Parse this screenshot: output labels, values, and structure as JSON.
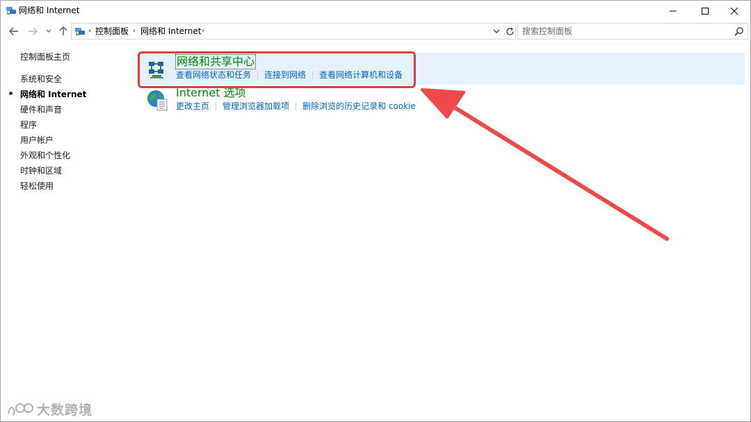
{
  "window": {
    "title": "网络和 Internet"
  },
  "address_bar": {
    "breadcrumbs": [
      "控制面板",
      "网络和 Internet"
    ],
    "search_placeholder": "搜索控制面板"
  },
  "left_nav": {
    "items": [
      {
        "label": "控制面板主页"
      },
      {
        "label": "系统和安全"
      },
      {
        "label": "网络和 Internet",
        "active": true
      },
      {
        "label": "硬件和声音"
      },
      {
        "label": "程序"
      },
      {
        "label": "用户帐户"
      },
      {
        "label": "外观和个性化"
      },
      {
        "label": "时钟和区域"
      },
      {
        "label": "轻松使用"
      }
    ]
  },
  "categories": [
    {
      "title": "网络和共享中心",
      "icon": "network-sharing-center-icon",
      "links": [
        "查看网络状态和任务",
        "连接到网络",
        "查看网络计算机和设备"
      ]
    },
    {
      "title": "Internet 选项",
      "icon": "internet-options-globe-icon",
      "links": [
        "更改主页",
        "管理浏览器加载项",
        "删除浏览的历史记录和 cookie"
      ]
    }
  ],
  "colors": {
    "category_title": "#008a00",
    "link": "#0066cc",
    "highlight_bg": "#e5f1fb",
    "annotation_red": "#e83a3a"
  },
  "watermark": {
    "text": "大数跨境"
  }
}
